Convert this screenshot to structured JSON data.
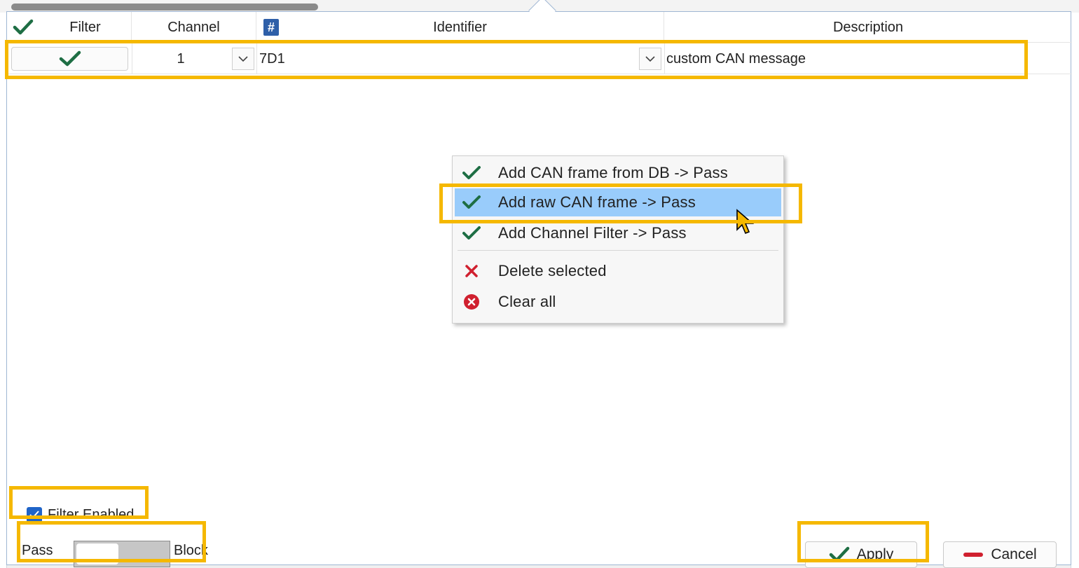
{
  "columns": {
    "filter": "Filter",
    "channel": "Channel",
    "identifier": "Identifier",
    "description": "Description",
    "identifier_icon_text": "#"
  },
  "row": {
    "channel": "1",
    "identifier": "7D1",
    "description": "custom CAN message"
  },
  "context_menu": {
    "items": [
      {
        "label": "Add CAN frame from DB -> Pass",
        "icon": "check-icon"
      },
      {
        "label": "Add raw CAN frame -> Pass",
        "icon": "check-icon",
        "selected": true
      },
      {
        "label": "Add Channel Filter -> Pass",
        "icon": "check-icon"
      },
      {
        "label": "Delete selected",
        "icon": "x-icon"
      },
      {
        "label": "Clear all",
        "icon": "x-circle-icon"
      }
    ]
  },
  "bottom": {
    "filter_enabled_label": "Filter Enabled",
    "filter_enabled": true,
    "pass_label": "Pass",
    "block_label": "Block",
    "mode": "Pass",
    "apply_label": "Apply",
    "cancel_label": "Cancel"
  },
  "colors": {
    "accent_green": "#1e6e44",
    "highlight": "#f5b800",
    "menu_selection": "#99ccfb",
    "delete_red": "#d0202f"
  }
}
